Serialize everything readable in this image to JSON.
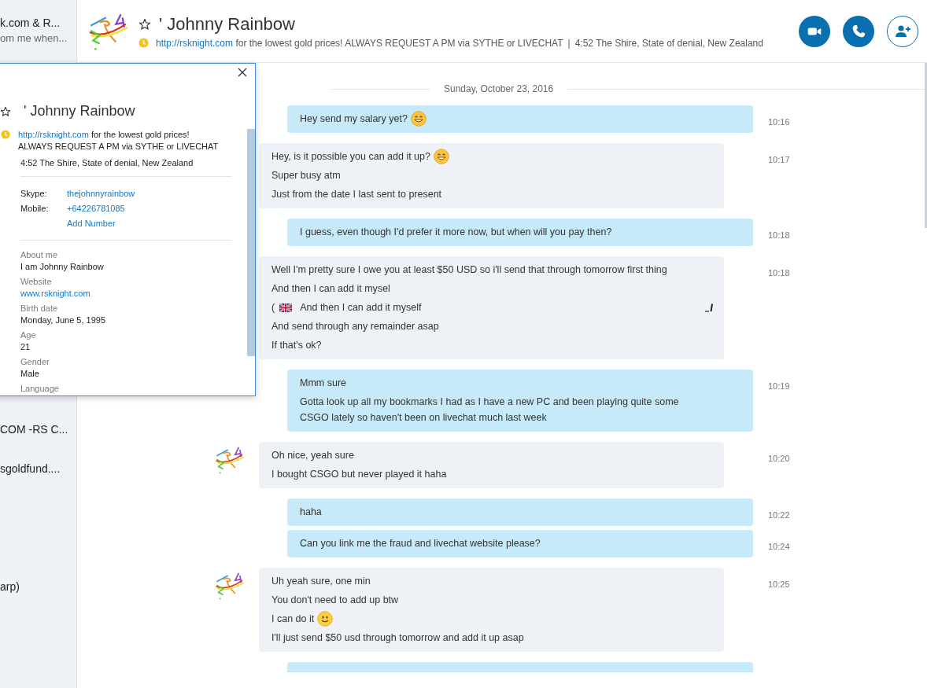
{
  "sidebar": {
    "items": [
      {
        "title": "k.com & R...",
        "subtitle": "om me when..."
      },
      {
        "title": "COM -RS C..."
      },
      {
        "title": "sgoldfund...."
      },
      {
        "title": "arp)"
      }
    ]
  },
  "header": {
    "name": "' Johnny Rainbow",
    "favorite": false,
    "status": {
      "link": "http://rsknight.com",
      "text": "for the lowest gold prices! ALWAYS REQUEST A PM via SYTHE or LIVECHAT",
      "separator": "|",
      "location": "4:52 The Shire, State of denial, New Zealand"
    },
    "buttons": [
      {
        "kind": "video"
      },
      {
        "kind": "call"
      },
      {
        "kind": "add-contact"
      }
    ]
  },
  "profile_popup": {
    "name": "' Johnny Rainbow",
    "favorite": false,
    "status": {
      "link": "http://rsknight.com",
      "text": "for the lowest gold prices!\nALWAYS REQUEST A PM via SYTHE or LIVECHAT"
    },
    "location": "4:52 The Shire, State of denial, New Zealand",
    "contacts": [
      {
        "label": "Skype:",
        "value": "thejohnnyrainbow"
      },
      {
        "label": "Mobile:",
        "value": "+64226781085"
      },
      {
        "value": "Add Number"
      }
    ],
    "details": [
      {
        "label": "About me",
        "value": "I am Johnny Rainbow",
        "kind": "text"
      },
      {
        "label": "Website",
        "value": "www.rsknight.com",
        "kind": "link"
      },
      {
        "label": "Birth date",
        "value": "Monday, June 5, 1995",
        "kind": "text"
      },
      {
        "label": "Age",
        "value": "21",
        "kind": "text"
      },
      {
        "label": "Gender",
        "value": "Male",
        "kind": "text"
      },
      {
        "label": "Language"
      }
    ]
  },
  "chat": {
    "date": "Sunday, October 23, 2016",
    "messages": [
      {
        "kind": "sent",
        "time": "10:16",
        "lines": [
          {
            "text": "Hey send my salary yet?",
            "emoji": {
              "kind": "grin"
            }
          }
        ]
      },
      {
        "kind": "received",
        "time": "10:17",
        "lines": [
          {
            "text": "Hey, is it possible you can add it up?",
            "emoji": {
              "kind": "grin"
            }
          },
          {
            "text": "Super busy atm"
          },
          {
            "text": "Just from the date I last sent to present"
          }
        ]
      },
      {
        "kind": "sent",
        "time": "10:18",
        "lines": [
          {
            "text": "I guess, even though I'd prefer it more now, but when will you pay then?"
          }
        ]
      },
      {
        "kind": "received",
        "time": "10:18",
        "lines": [
          {
            "text": "Well I'm pretty sure I owe you at least $50 USD so i'll send that through tomorrow first thing"
          },
          {
            "text": "And then I can add it mysel"
          },
          {
            "prefix": "(",
            "flag": true,
            "text": "And then I can add it myself",
            "edited": true
          },
          {
            "text": "And send through any remainder asap"
          },
          {
            "text": "If that's ok?"
          }
        ]
      },
      {
        "kind": "sent",
        "time": "10:19",
        "lines": [
          {
            "text": "Mmm sure"
          },
          {
            "text": "Gotta look up all my bookmarks I had as I have a new PC and been playing quite some CSGO lately so haven't been on livechat much last week"
          }
        ]
      },
      {
        "kind": "received",
        "avatar": true,
        "time": "10:20",
        "lines": [
          {
            "text": "Oh nice, yeah sure"
          },
          {
            "text": "I bought CSGO but never played it haha"
          }
        ]
      },
      {
        "kind": "sent",
        "time": "10:22",
        "lines": [
          {
            "text": "haha"
          }
        ]
      },
      {
        "kind": "sent",
        "time": "10:24",
        "lines": [
          {
            "text": "Can you link me the fraud and livechat website please?"
          }
        ]
      },
      {
        "kind": "received",
        "avatar": true,
        "time": "10:25",
        "lines": [
          {
            "text": "Uh yeah sure, one min"
          },
          {
            "text": "You don't need to add up btw"
          },
          {
            "text": "I can do it",
            "emoji": {
              "kind": "smile"
            }
          },
          {
            "text": "I'll just send $50 usd through tomorrow and add it up asap"
          }
        ]
      },
      {
        "kind": "sent"
      }
    ]
  }
}
